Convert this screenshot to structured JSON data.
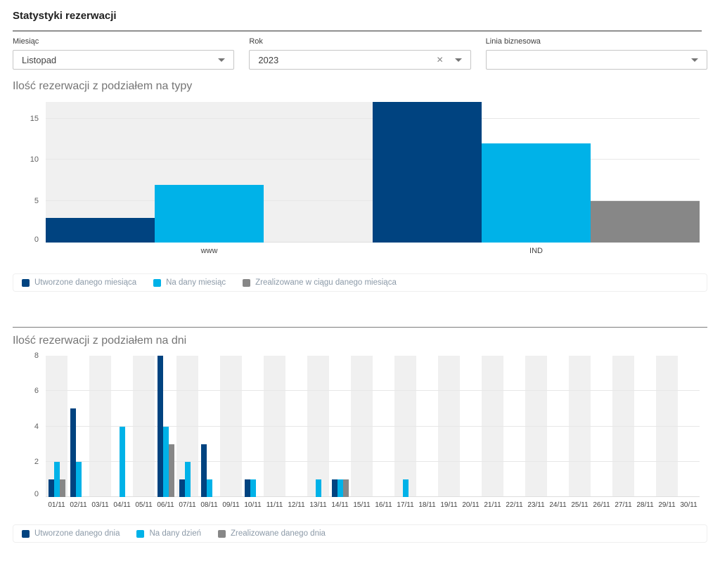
{
  "page_title": "Statystyki rezerwacji",
  "filters": {
    "month": {
      "label": "Miesiąc",
      "value": "Listopad"
    },
    "year": {
      "label": "Rok",
      "value": "2023"
    },
    "business_line": {
      "label": "Linia biznesowa",
      "value": ""
    }
  },
  "icons": {
    "clear": "✕",
    "caret": "chevron-down"
  },
  "colors": {
    "series_dark_blue": "#004380",
    "series_cyan": "#00b2e8",
    "series_gray": "#878787",
    "band_shade": "#f0f0f0"
  },
  "chart_data": [
    {
      "type": "bar",
      "title": "Ilość rezerwacji z podziałem na typy",
      "categories": [
        "www",
        "IND"
      ],
      "series": [
        {
          "name": "Utworzone danego miesiąca",
          "color": "#004380",
          "values": [
            3,
            17
          ]
        },
        {
          "name": "Na dany miesiąc",
          "color": "#00b2e8",
          "values": [
            7,
            12
          ]
        },
        {
          "name": "Zrealizowane w ciągu danego miesiąca",
          "color": "#878787",
          "values": [
            0,
            5
          ]
        }
      ],
      "yticks": [
        0,
        5,
        10,
        15
      ],
      "ymax": 17,
      "legend_position": "bottom",
      "grid": true,
      "band_pattern": "alternating-shaded-first"
    },
    {
      "type": "bar",
      "title": "Ilość rezerwacji z podziałem na dni",
      "categories": [
        "01/11",
        "02/11",
        "03/11",
        "04/11",
        "05/11",
        "06/11",
        "07/11",
        "08/11",
        "09/11",
        "10/11",
        "11/11",
        "12/11",
        "13/11",
        "14/11",
        "15/11",
        "16/11",
        "17/11",
        "18/11",
        "19/11",
        "20/11",
        "21/11",
        "22/11",
        "23/11",
        "24/11",
        "25/11",
        "26/11",
        "27/11",
        "28/11",
        "29/11",
        "30/11"
      ],
      "series": [
        {
          "name": "Utworzone danego dnia",
          "color": "#004380",
          "values": [
            1,
            5,
            0,
            0,
            0,
            8,
            1,
            3,
            0,
            1,
            0,
            0,
            0,
            1,
            0,
            0,
            0,
            0,
            0,
            0,
            0,
            0,
            0,
            0,
            0,
            0,
            0,
            0,
            0,
            0
          ]
        },
        {
          "name": "Na dany dzień",
          "color": "#00b2e8",
          "values": [
            2,
            2,
            0,
            4,
            0,
            4,
            2,
            1,
            0,
            1,
            0,
            0,
            1,
            1,
            0,
            0,
            1,
            0,
            0,
            0,
            0,
            0,
            0,
            0,
            0,
            0,
            0,
            0,
            0,
            0
          ]
        },
        {
          "name": "Zrealizowane danego dnia",
          "color": "#878787",
          "values": [
            1,
            0,
            0,
            0,
            0,
            3,
            0,
            0,
            0,
            0,
            0,
            0,
            0,
            1,
            0,
            0,
            0,
            0,
            0,
            0,
            0,
            0,
            0,
            0,
            0,
            0,
            0,
            0,
            0,
            0
          ]
        }
      ],
      "yticks": [
        0,
        2,
        4,
        6,
        8
      ],
      "ymax": 8,
      "legend_position": "bottom",
      "grid": true,
      "band_pattern": "alternating-shaded-first"
    }
  ]
}
